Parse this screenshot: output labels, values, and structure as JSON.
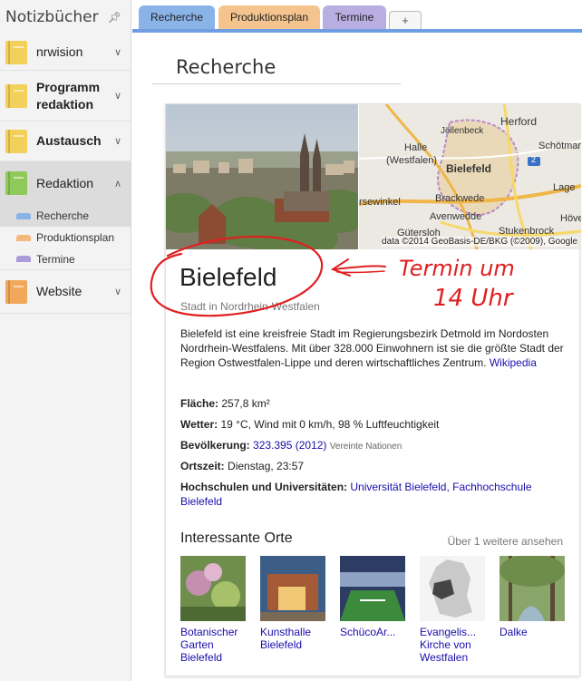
{
  "sidebar": {
    "title": "Notizbücher",
    "pin_icon": "pin-icon",
    "notebooks": [
      {
        "label": "nrwision",
        "color": "#f2d05a",
        "bold": false
      },
      {
        "label": "Programm redaktion",
        "color": "#f2d05a",
        "bold": true
      },
      {
        "label": "Austausch",
        "color": "#f2d05a",
        "bold": true
      },
      {
        "label": "Redaktion",
        "color": "#8fc95a",
        "bold": false,
        "expanded": true
      },
      {
        "label": "Website",
        "color": "#f2a85a",
        "bold": false
      }
    ],
    "sections": [
      {
        "label": "Recherche",
        "color": "#8ab3e8"
      },
      {
        "label": "Produktionsplan",
        "color": "#f2b97a"
      },
      {
        "label": "Termine",
        "color": "#a99ad8"
      }
    ]
  },
  "tabs": [
    {
      "label": "Recherche",
      "color": "#8ab3e8",
      "active": true
    },
    {
      "label": "Produktionsplan",
      "color": "#f5c48e"
    },
    {
      "label": "Termine",
      "color": "#b8aee2"
    },
    {
      "label": "+"
    }
  ],
  "page": {
    "title": "Recherche"
  },
  "card": {
    "map_places": [
      "Herford",
      "Jöllenbeck",
      "Schötmar",
      "Halle",
      "(Westfalen)",
      "Bielefeld",
      "2",
      "Brackwede",
      "Lage",
      "rsewinkel",
      "Avenwedde",
      "Stukenbrock",
      "Gütersloh",
      "Hövel"
    ],
    "map_credit": "data ©2014 GeoBasis-DE/BKG (©2009), Google",
    "name": "Bielefeld",
    "subtitle": "Stadt in Nordrhein-Westfalen",
    "description": "Bielefeld ist eine kreisfreie Stadt im Regierungsbezirk Detmold im Nordosten Nordrhein-Westfalens. Mit über 328.000 Einwohnern ist sie die größte Stadt der Region Ostwestfalen-Lippe und deren wirtschaftliches Zentrum.",
    "description_link": "Wikipedia",
    "facts": {
      "flaeche_label": "Fläche:",
      "flaeche_value": "257,8 km²",
      "wetter_label": "Wetter:",
      "wetter_value": "19 °C, Wind mit 0 km/h, 98 % Luftfeuchtigkeit",
      "bevoelkerung_label": "Bevölkerung:",
      "bevoelkerung_value": "323.395 (2012)",
      "bevoelkerung_source": "Vereinte Nationen",
      "ortszeit_label": "Ortszeit:",
      "ortszeit_value": "Dienstag, 23:57",
      "hochschulen_label": "Hochschulen und Universitäten:",
      "hochschulen_value_1": "Universität Bielefeld",
      "hochschulen_sep": ", ",
      "hochschulen_value_2": "Fachhochschule Bielefeld"
    },
    "places_title": "Interessante Orte",
    "places_more": "Über 1 weitere ansehen",
    "places": [
      {
        "label": "Botanischer Garten Bielefeld"
      },
      {
        "label": "Kunsthalle Bielefeld"
      },
      {
        "label": "SchücoAr..."
      },
      {
        "label": "Evangelis... Kirche von Westfalen"
      },
      {
        "label": "Dalke"
      }
    ]
  },
  "annotation": {
    "line1": "Termin um",
    "line2": "14 Uhr",
    "color": "#e02020"
  }
}
